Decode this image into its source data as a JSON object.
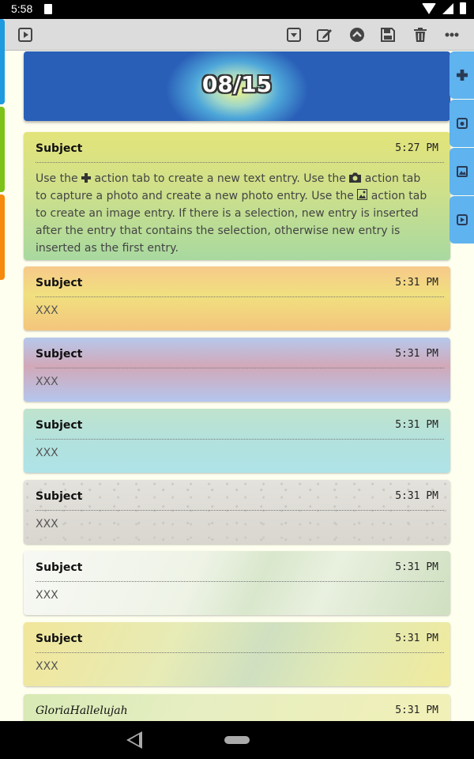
{
  "status_bar": {
    "time": "5:58"
  },
  "toolbar": {
    "icons": [
      "play-icon",
      "collapse-icon",
      "edit-icon",
      "up-icon",
      "save-icon",
      "delete-icon",
      "more-icon"
    ]
  },
  "banner": {
    "date": "08/15"
  },
  "side_tabs": [
    "add-text-icon",
    "camera-icon",
    "image-icon",
    "play-icon"
  ],
  "entries": [
    {
      "subject": "Subject",
      "time": "5:27 PM",
      "body_parts": [
        "Use the ",
        " action tab to create a new text entry. Use the ",
        " action tab to capture a photo and create a new photo entry. Use the ",
        " action tab to create an image entry. If there is a selection, new entry is inserted after the entry that contains the selection, otherwise new entry is inserted as the first entry."
      ]
    },
    {
      "subject": "Subject",
      "time": "5:31 PM",
      "body": "XXX"
    },
    {
      "subject": "Subject",
      "time": "5:31 PM",
      "body": "XXX"
    },
    {
      "subject": "Subject",
      "time": "5:31 PM",
      "body": "XXX"
    },
    {
      "subject": "Subject",
      "time": "5:31 PM",
      "body": "XXX"
    },
    {
      "subject": "Subject",
      "time": "5:31 PM",
      "body": "XXX"
    },
    {
      "subject": "Subject",
      "time": "5:31 PM",
      "body": "XXX"
    },
    {
      "subject": "GloriaHallelujah",
      "time": "5:31 PM"
    }
  ]
}
